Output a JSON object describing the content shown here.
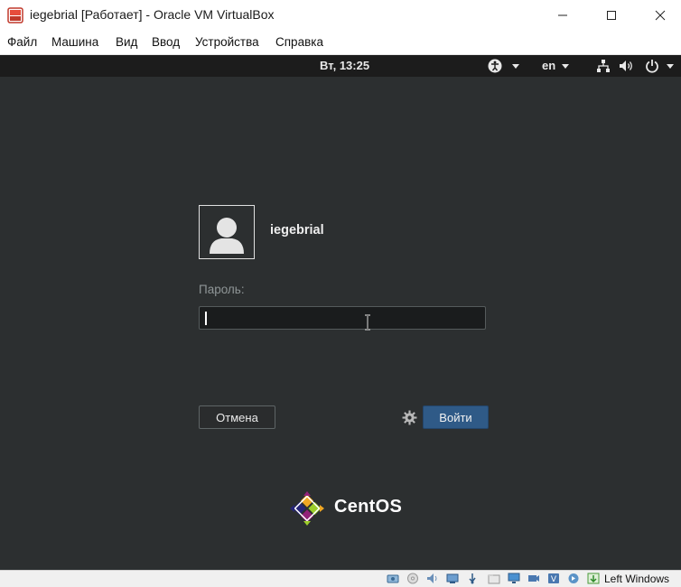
{
  "window": {
    "title": "iegebrial [Работает] - Oracle VM VirtualBox",
    "minimize_symbol": "—",
    "maximize_symbol": "☐",
    "close_symbol": "✕"
  },
  "menubar": {
    "items": [
      "Файл",
      "Машина",
      "Вид",
      "Ввод",
      "Устройства",
      "Справка"
    ]
  },
  "guest_topbar": {
    "clock": "Вт, 13:25",
    "language": "en",
    "icons": [
      "accessibility-icon",
      "network-icon",
      "volume-icon",
      "power-icon"
    ]
  },
  "login": {
    "username": "iegebrial",
    "password_label": "Пароль:",
    "password_value": "",
    "cancel_label": "Отмена",
    "login_label": "Войти",
    "brand": "CentOS"
  },
  "statusbar": {
    "host_key": "Left Windows",
    "icons": [
      "hdd-icon",
      "optical-disk-icon",
      "audio-icon",
      "network-icon",
      "usb-icon",
      "shared-folders-icon",
      "display-icon",
      "video-capture-icon",
      "cpu-virtualization-icon",
      "mouse-integration-icon",
      "keyboard-capture-icon"
    ]
  },
  "colors": {
    "guest_background": "#2c2f30",
    "topbar": "#1c1c1c",
    "login_button": "#2f5a87"
  }
}
